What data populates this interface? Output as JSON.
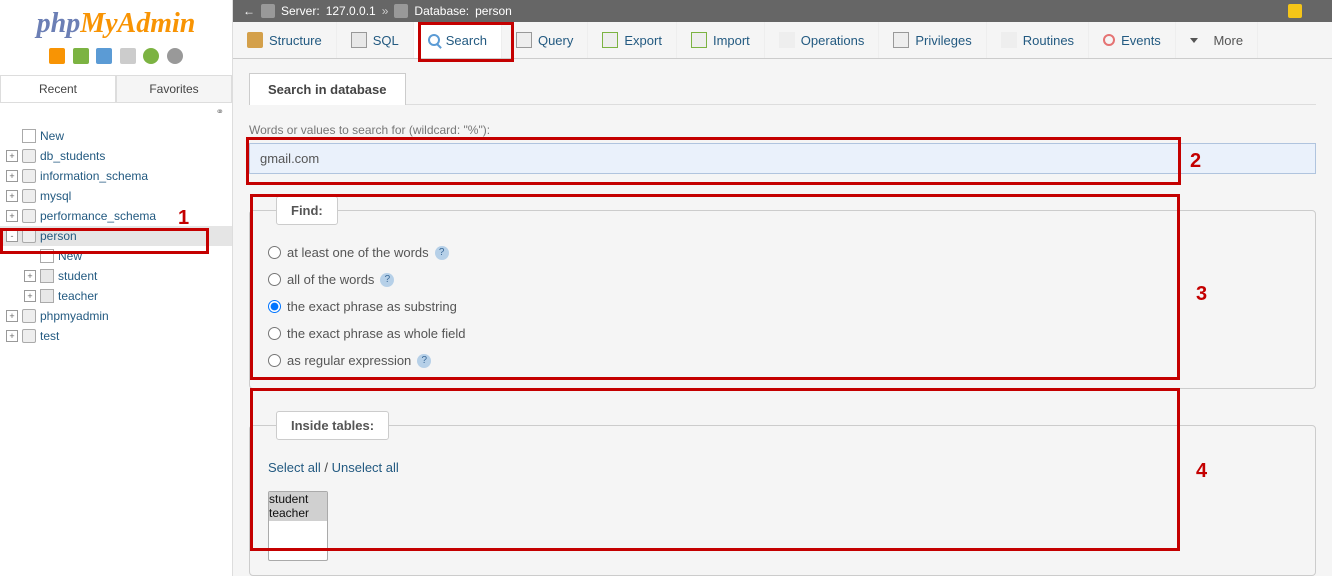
{
  "logo": {
    "php": "php",
    "my": "My",
    "admin": "Admin"
  },
  "sidebar": {
    "tabs": {
      "recent": "Recent",
      "favorites": "Favorites"
    },
    "tree": [
      {
        "label": "New",
        "type": "new",
        "indent": 0,
        "toggle": null
      },
      {
        "label": "db_students",
        "type": "db",
        "indent": 0,
        "toggle": "+"
      },
      {
        "label": "information_schema",
        "type": "db",
        "indent": 0,
        "toggle": "+"
      },
      {
        "label": "mysql",
        "type": "db",
        "indent": 0,
        "toggle": "+"
      },
      {
        "label": "performance_schema",
        "type": "db",
        "indent": 0,
        "toggle": "+"
      },
      {
        "label": "person",
        "type": "db",
        "indent": 0,
        "toggle": "-",
        "selected": true
      },
      {
        "label": "New",
        "type": "new",
        "indent": 1,
        "toggle": null
      },
      {
        "label": "student",
        "type": "table",
        "indent": 1,
        "toggle": "+"
      },
      {
        "label": "teacher",
        "type": "table",
        "indent": 1,
        "toggle": "+"
      },
      {
        "label": "phpmyadmin",
        "type": "db",
        "indent": 0,
        "toggle": "+"
      },
      {
        "label": "test",
        "type": "db",
        "indent": 0,
        "toggle": "+"
      }
    ]
  },
  "breadcrumb": {
    "back": "←",
    "server_label": "Server:",
    "server_value": "127.0.0.1",
    "sep": "»",
    "db_label": "Database:",
    "db_value": "person"
  },
  "tabs": {
    "structure": "Structure",
    "sql": "SQL",
    "search": "Search",
    "query": "Query",
    "export": "Export",
    "import": "Import",
    "operations": "Operations",
    "privileges": "Privileges",
    "routines": "Routines",
    "events": "Events",
    "more": "More"
  },
  "search": {
    "panel_title": "Search in database",
    "words_label": "Words or values to search for (wildcard: \"%\"):",
    "input_value": "gmail.com",
    "find_legend": "Find:",
    "options": {
      "at_least_one": "at least one of the words",
      "all_words": "all of the words",
      "exact_substring": "the exact phrase as substring",
      "exact_whole": "the exact phrase as whole field",
      "regex": "as regular expression"
    },
    "inside_legend": "Inside tables:",
    "select_all": "Select all",
    "unselect_all": "Unselect all",
    "slash": " / ",
    "tables": [
      "student",
      "teacher"
    ]
  },
  "annotations": {
    "a1": "1",
    "a2": "2",
    "a3": "3",
    "a4": "4"
  }
}
